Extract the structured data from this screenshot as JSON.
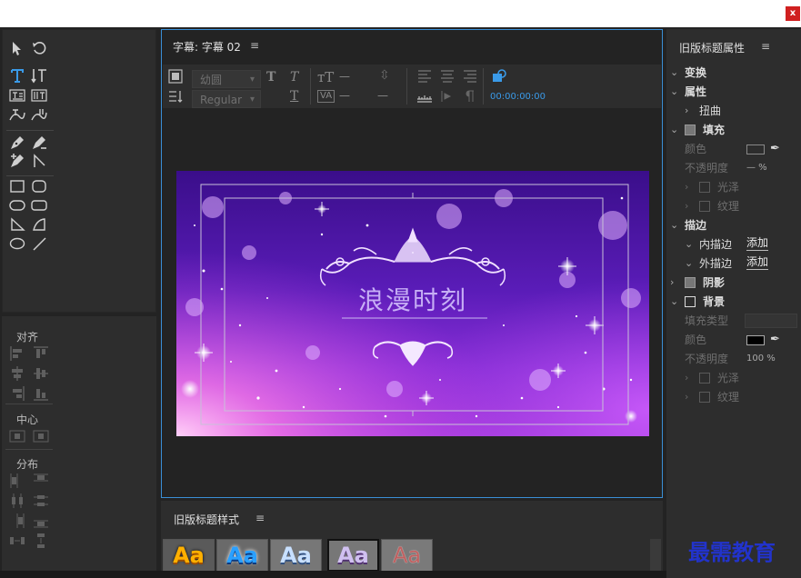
{
  "window": {
    "close_label": "x"
  },
  "align_panel": {
    "align_label": "对齐",
    "center_label": "中心",
    "distribute_label": "分布"
  },
  "main_panel": {
    "tab_label": "字幕: 字幕 02",
    "menu_glyph": "≡",
    "toolbar": {
      "font_family": "幼圆",
      "font_style": "Regular",
      "timecode": "00:00:00:00",
      "dash1": "—",
      "dash2": "—",
      "dash3": "—"
    },
    "canvas": {
      "title_text": "浪漫时刻",
      "bg_colors": [
        "#2a0a6e",
        "#6a1fc4",
        "#b040e0",
        "#ff9cf0"
      ]
    }
  },
  "styles_panel": {
    "tab_label": "旧版标题样式",
    "menu_glyph": "≡",
    "swatches": [
      {
        "text": "Aa",
        "style": "gold"
      },
      {
        "text": "Aa",
        "style": "blue"
      },
      {
        "text": "Aa",
        "style": "chrome-blue"
      },
      {
        "text": "Aa",
        "style": "lavender"
      },
      {
        "text": "Aa",
        "style": "red-outline"
      }
    ]
  },
  "properties_panel": {
    "title": "旧版标题属性",
    "menu_glyph": "≡",
    "transform": "变换",
    "properties": "属性",
    "distort": "扭曲",
    "fill": "填充",
    "color": "颜色",
    "opacity": "不透明度",
    "opacity_value": "— %",
    "sheen": "光泽",
    "texture": "纹理",
    "strokes": "描边",
    "inner_stroke": "内描边",
    "outer_stroke": "外描边",
    "add": "添加",
    "shadow": "阴影",
    "background": "背景",
    "fill_type": "填充类型",
    "bg_color": "颜色",
    "bg_opacity": "不透明度",
    "bg_opacity_value": "100 %",
    "bg_sheen": "光泽",
    "bg_texture": "纹理"
  },
  "watermark": {
    "text": "最需教育",
    "color": "#2233cc"
  }
}
